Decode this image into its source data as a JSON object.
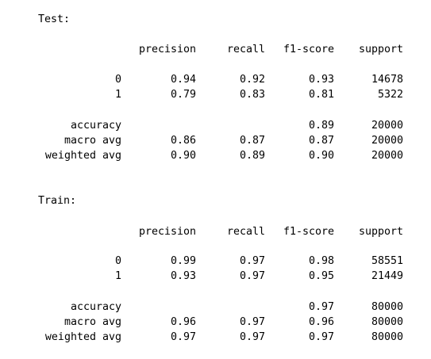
{
  "reports": [
    {
      "title": "Test:",
      "headers": [
        "precision",
        "recall",
        "f1-score",
        "support"
      ],
      "class_rows": [
        {
          "label": "0",
          "precision": "0.94",
          "recall": "0.92",
          "f1": "0.93",
          "support": "14678"
        },
        {
          "label": "1",
          "precision": "0.79",
          "recall": "0.83",
          "f1": "0.81",
          "support": "5322"
        }
      ],
      "summary_rows": [
        {
          "label": "accuracy",
          "precision": "",
          "recall": "",
          "f1": "0.89",
          "support": "20000"
        },
        {
          "label": "macro avg",
          "precision": "0.86",
          "recall": "0.87",
          "f1": "0.87",
          "support": "20000"
        },
        {
          "label": "weighted avg",
          "precision": "0.90",
          "recall": "0.89",
          "f1": "0.90",
          "support": "20000"
        }
      ]
    },
    {
      "title": "Train:",
      "headers": [
        "precision",
        "recall",
        "f1-score",
        "support"
      ],
      "class_rows": [
        {
          "label": "0",
          "precision": "0.99",
          "recall": "0.97",
          "f1": "0.98",
          "support": "58551"
        },
        {
          "label": "1",
          "precision": "0.93",
          "recall": "0.97",
          "f1": "0.95",
          "support": "21449"
        }
      ],
      "summary_rows": [
        {
          "label": "accuracy",
          "precision": "",
          "recall": "",
          "f1": "0.97",
          "support": "80000"
        },
        {
          "label": "macro avg",
          "precision": "0.96",
          "recall": "0.97",
          "f1": "0.96",
          "support": "80000"
        },
        {
          "label": "weighted avg",
          "precision": "0.97",
          "recall": "0.97",
          "f1": "0.97",
          "support": "80000"
        }
      ]
    }
  ]
}
